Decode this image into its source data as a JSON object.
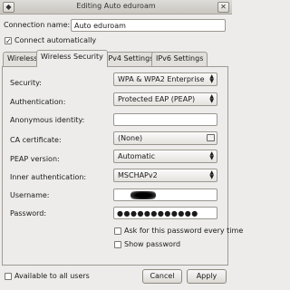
{
  "window": {
    "title": "Editing Auto eduroam",
    "buttons": {
      "menu": "◆",
      "close": "✕"
    }
  },
  "connection": {
    "name_label": "Connection name:",
    "name_value": "Auto eduroam",
    "auto_connect_label": "Connect automatically",
    "auto_connect_checked": true
  },
  "tabs": [
    {
      "label": "Wireless",
      "active": false
    },
    {
      "label": "Wireless Security",
      "active": true
    },
    {
      "label": "IPv4 Settings",
      "active": false
    },
    {
      "label": "IPv6 Settings",
      "active": false
    }
  ],
  "security": {
    "security_label": "Security:",
    "security_value": "WPA & WPA2 Enterprise",
    "auth_label": "Authentication:",
    "auth_value": "Protected EAP (PEAP)",
    "anon_label": "Anonymous identity:",
    "anon_value": "",
    "ca_label": "CA certificate:",
    "ca_value": "(None)",
    "peap_label": "PEAP version:",
    "peap_value": "Automatic",
    "inner_label": "Inner authentication:",
    "inner_value": "MSCHAPv2",
    "username_label": "Username:",
    "password_label": "Password:",
    "password_value": "●●●●●●●●●●●●",
    "ask_password_label": "Ask for this password every time",
    "show_password_label": "Show password"
  },
  "footer": {
    "available_label": "Available to all users",
    "cancel_label": "Cancel",
    "apply_label": "Apply"
  },
  "icons": {
    "check": "✓",
    "combo_arrows_up": "▲",
    "combo_arrows_down": "▼"
  }
}
